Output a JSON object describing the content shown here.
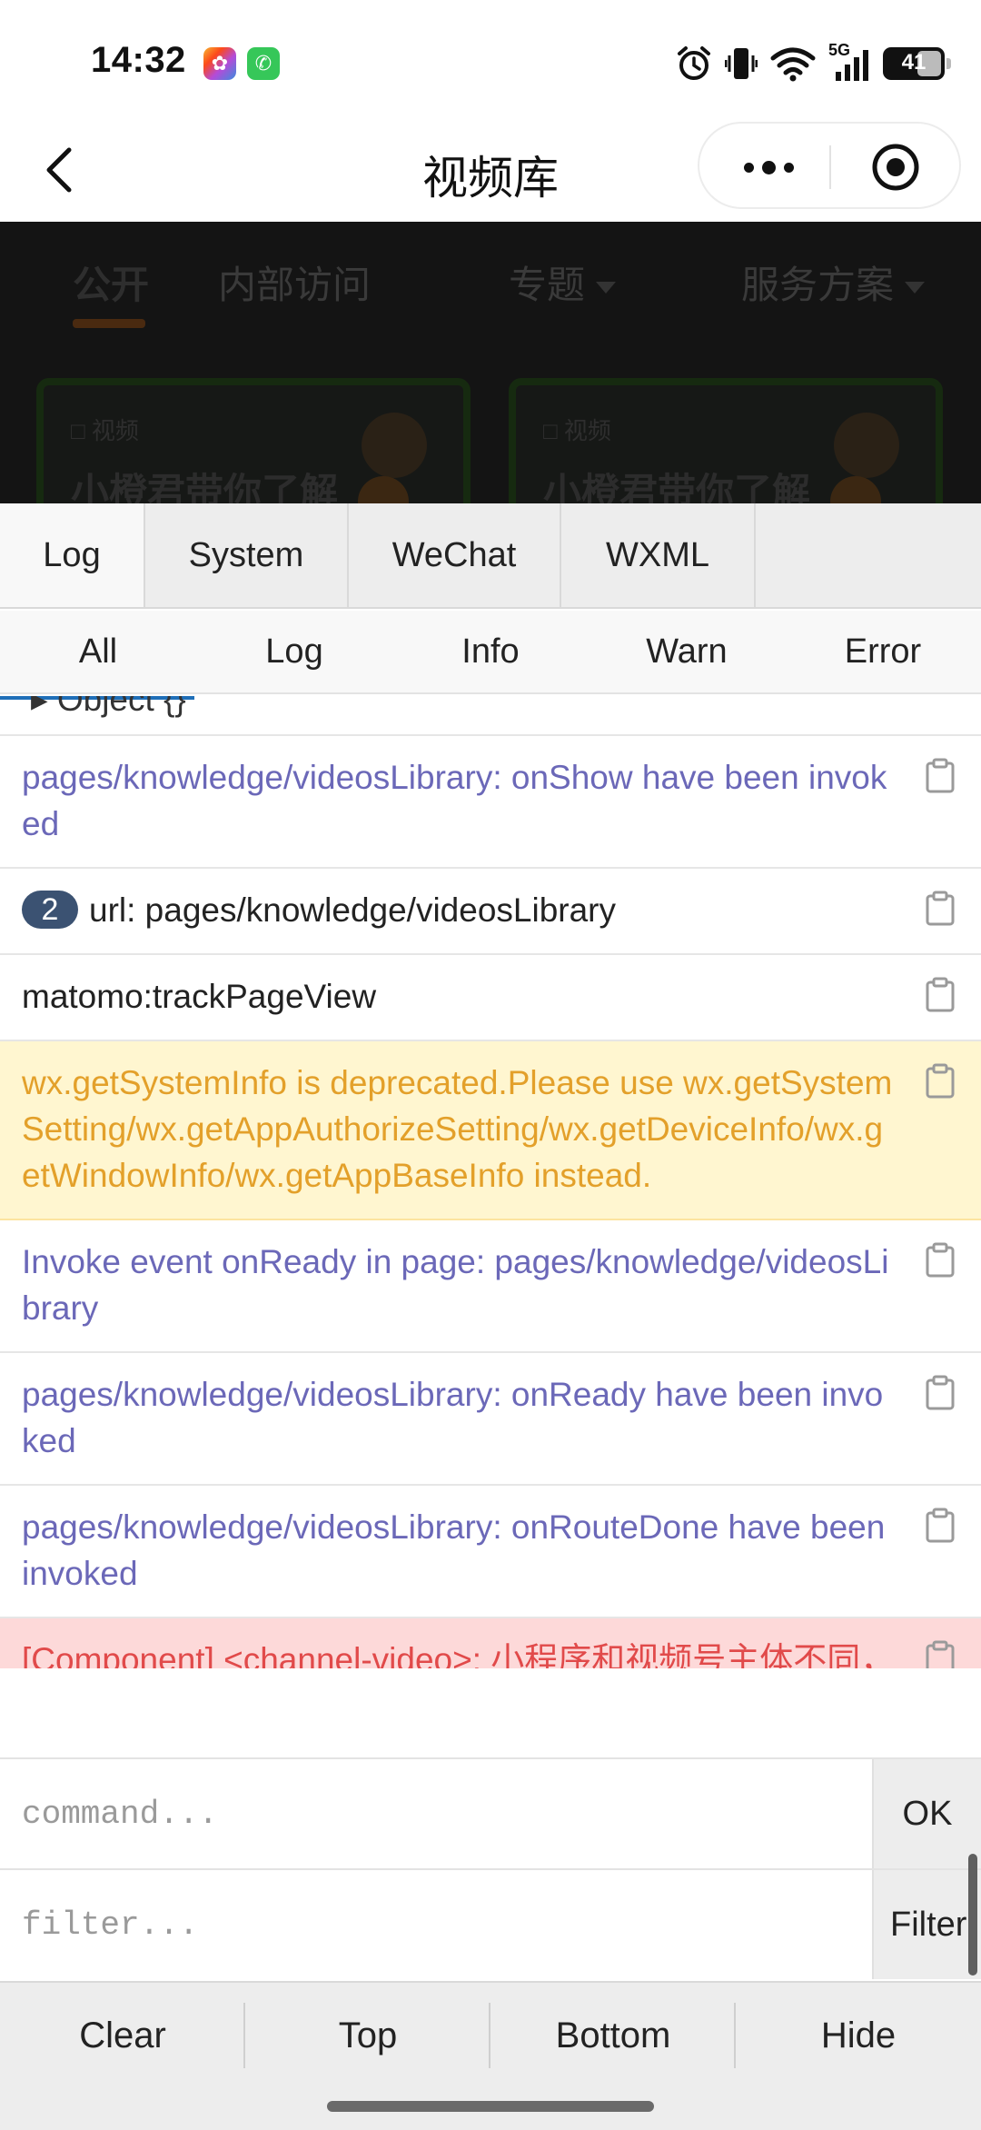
{
  "status_bar": {
    "time": "14:32",
    "network": "5G",
    "battery": "41",
    "icons": [
      "photos-app-icon",
      "phone-app-icon",
      "alarm-icon",
      "vibrate-icon",
      "wifi-icon",
      "signal-icon",
      "battery-icon"
    ]
  },
  "nav": {
    "title": "视频库",
    "back_icon": "chevron-left-icon",
    "more_icon": "more-dots-icon",
    "close_icon": "target-close-icon"
  },
  "page_behind": {
    "tabs": [
      "公开",
      "内部访问",
      "专题",
      "服务方案"
    ],
    "cards": [
      {
        "badge": "□ 视频",
        "title": "小橙君带你了解"
      },
      {
        "badge": "□ 视频",
        "title": "小橙君带你了解"
      }
    ]
  },
  "vconsole": {
    "tabs": [
      "Log",
      "System",
      "WeChat",
      "WXML"
    ],
    "subtabs": [
      "All",
      "Log",
      "Info",
      "Warn",
      "Error"
    ],
    "partial_entry": "▸ Object {}",
    "logs": [
      {
        "level": "info",
        "text": "pages/knowledge/videosLibrary: onShow have been invoked"
      },
      {
        "level": "log",
        "repeat": "2",
        "text": "url: pages/knowledge/videosLibrary"
      },
      {
        "level": "log",
        "text": "matomo:trackPageView"
      },
      {
        "level": "warn",
        "text": "wx.getSystemInfo is deprecated.Please use wx.getSystemSetting/wx.getAppAuthorizeSetting/wx.getDeviceInfo/wx.getWindowInfo/wx.getAppBaseInfo instead."
      },
      {
        "level": "info",
        "text": "Invoke event onReady in page: pages/knowledge/videosLibrary"
      },
      {
        "level": "info",
        "text": "pages/knowledge/videosLibrary: onReady have been invoked"
      },
      {
        "level": "info",
        "text": "pages/knowledge/videosLibrary: onRouteDone have been invoked"
      },
      {
        "level": "error",
        "text": "[Component] <channel-video>: 小程序和视频号主体不同，无法播放。"
      }
    ],
    "command": {
      "placeholder": "command...",
      "button": "OK"
    },
    "filter": {
      "placeholder": "filter...",
      "button": "Filter"
    },
    "toolbar": [
      "Clear",
      "Top",
      "Bottom",
      "Hide"
    ]
  },
  "colors": {
    "info": "#6b68b8",
    "warn_text": "#e3a02a",
    "warn_bg": "#fff6d0",
    "error_text": "#e14a4a",
    "error_bg": "#fdd9d9",
    "repeat_badge": "#3b5272"
  }
}
